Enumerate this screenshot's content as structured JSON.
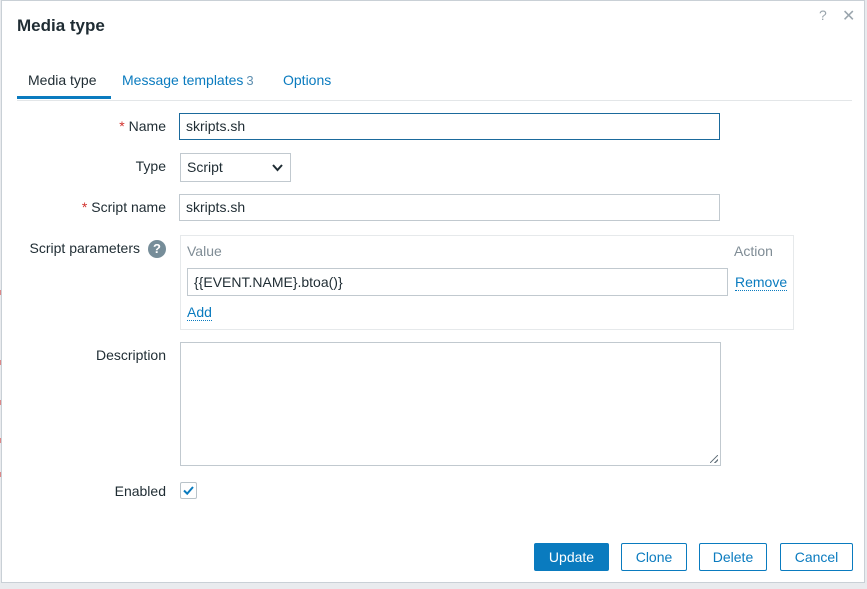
{
  "dialog": {
    "title": "Media type",
    "help_glyph": "?",
    "close_glyph": "✕"
  },
  "tabs": [
    {
      "label": "Media type",
      "active": true
    },
    {
      "label": "Message templates",
      "count": "3"
    },
    {
      "label": "Options"
    }
  ],
  "form": {
    "name": {
      "label": "Name",
      "required": true,
      "value": "skripts.sh"
    },
    "type": {
      "label": "Type",
      "selected": "Script"
    },
    "script_name": {
      "label": "Script name",
      "required": true,
      "value": "skripts.sh"
    },
    "script_parameters": {
      "label": "Script parameters",
      "columns": {
        "value": "Value",
        "action": "Action"
      },
      "rows": [
        {
          "value": "{{EVENT.NAME}.btoa()}",
          "action": "Remove"
        }
      ],
      "add_label": "Add"
    },
    "description": {
      "label": "Description",
      "value": ""
    },
    "enabled": {
      "label": "Enabled",
      "checked": true
    }
  },
  "buttons": {
    "update": "Update",
    "clone": "Clone",
    "delete": "Delete",
    "cancel": "Cancel"
  },
  "colors": {
    "accent": "#0a7bbf",
    "required": "#d1322e"
  },
  "icons": {
    "help": "help-icon",
    "close": "close-icon",
    "select_arrow": "chevron-down-icon",
    "checkbox": "check-icon"
  }
}
